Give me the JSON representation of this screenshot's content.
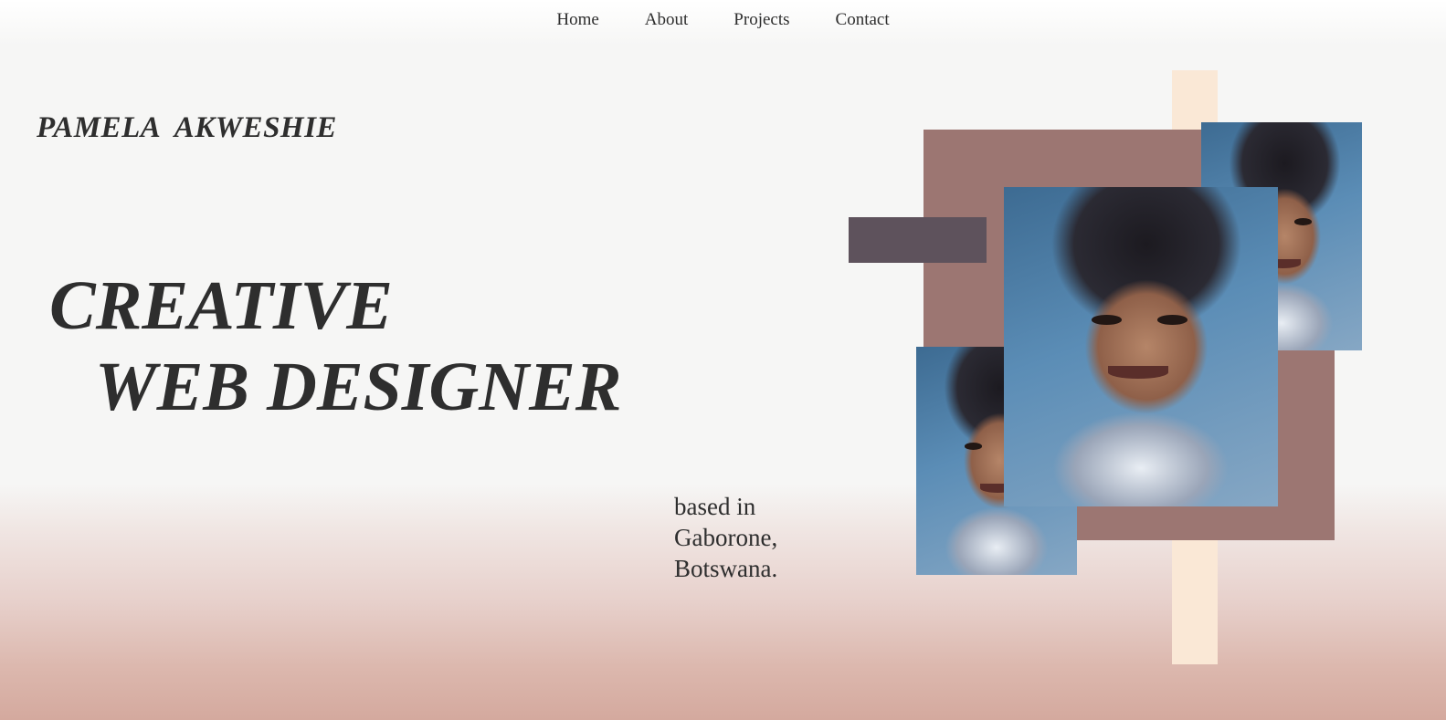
{
  "nav": {
    "items": [
      {
        "label": "Home"
      },
      {
        "label": "About"
      },
      {
        "label": "Projects"
      },
      {
        "label": "Contact"
      }
    ]
  },
  "brand": {
    "name": "PAMELA  AKWESHIE"
  },
  "hero": {
    "line1": "CREATIVE",
    "line2": "WEB DESIGNER"
  },
  "location": {
    "line1": "based in",
    "line2": "Gaborone,",
    "line3": "Botswana."
  },
  "colors": {
    "text": "#2e2e2e",
    "cream_bar": "#fae8d6",
    "mauve_block": "#9c7672",
    "dark_block": "#5e525c",
    "gradient_bottom": "#d4a99e"
  },
  "photos": [
    {
      "name": "portrait-photo-main"
    },
    {
      "name": "portrait-photo-top-right"
    },
    {
      "name": "portrait-photo-bottom-left"
    }
  ]
}
